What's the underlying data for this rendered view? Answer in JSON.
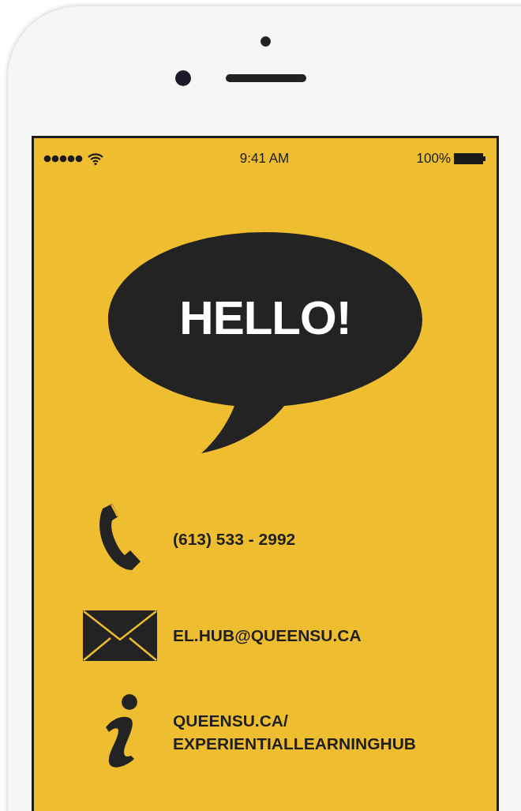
{
  "status_bar": {
    "time": "9:41 AM",
    "battery": "100%"
  },
  "greeting": "HELLO!",
  "contacts": [
    {
      "kind": "phone",
      "lines": [
        "(613) 533 - 2992"
      ]
    },
    {
      "kind": "email",
      "lines": [
        "EL.HUB@QUEENSU.CA"
      ]
    },
    {
      "kind": "web",
      "lines": [
        "QUEENSU.CA/",
        "EXPERIENTIALLEARNINGHUB"
      ]
    }
  ]
}
